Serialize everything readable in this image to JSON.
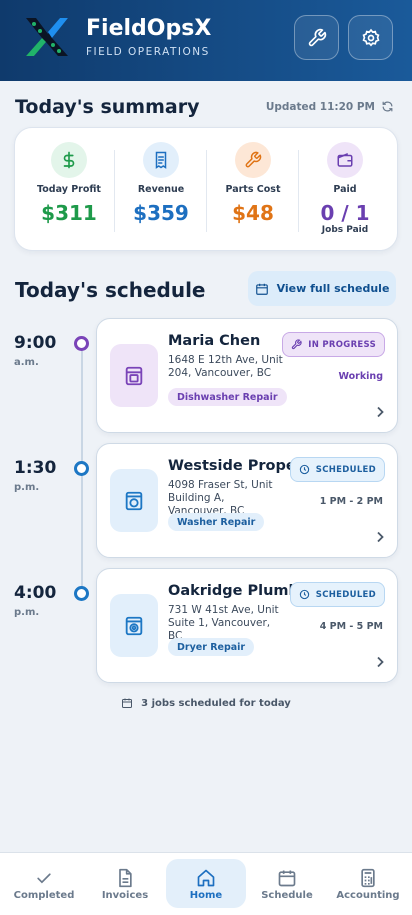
{
  "header": {
    "title": "FieldOpsX",
    "subtitle": "FIELD OPERATIONS",
    "icons": [
      "wrench-icon",
      "settings-gear-icon"
    ]
  },
  "summary": {
    "title": "Today's summary",
    "updated": "Updated 11:20 PM",
    "stats": [
      {
        "label": "Today Profit",
        "value": "$311",
        "icon": "dollar-icon",
        "color": "#1e9a4a"
      },
      {
        "label": "Revenue",
        "value": "$359",
        "icon": "receipt-icon",
        "color": "#1d6fc0"
      },
      {
        "label": "Parts Cost",
        "value": "$48",
        "icon": "wrench-icon",
        "color": "#e07416"
      },
      {
        "label": "Paid",
        "value": "0 / 1",
        "sub": "Jobs Paid",
        "icon": "wallet-icon",
        "color": "#6a3fb0"
      }
    ]
  },
  "schedule": {
    "title": "Today's schedule",
    "view_full": "View full schedule",
    "jobs": [
      {
        "time": "9:00",
        "ampm": "a.m.",
        "name": "Maria Chen",
        "address": "1648 E 12th Ave, Unit 204, Vancouver, BC",
        "tag": "Dishwasher Repair",
        "status": "IN PROGRESS",
        "status_sub": "Working",
        "accent": "#7a44b8"
      },
      {
        "time": "1:30",
        "ampm": "p.m.",
        "name": "Westside Properties",
        "address": "4098 Fraser St, Unit Building A, Vancouver, BC",
        "tag": "Washer Repair",
        "status": "SCHEDULED",
        "status_sub": "1 PM - 2 PM",
        "accent": "#1d77c4"
      },
      {
        "time": "4:00",
        "ampm": "p.m.",
        "name": "Oakridge Plumbing",
        "address": "731 W 41st Ave, Unit Suite 1, Vancouver, BC",
        "tag": "Dryer Repair",
        "status": "SCHEDULED",
        "status_sub": "4 PM - 5 PM",
        "accent": "#1d77c4"
      }
    ],
    "footnote": "3 jobs scheduled for today"
  },
  "nav": {
    "items": [
      {
        "label": "Completed",
        "icon": "check-icon"
      },
      {
        "label": "Invoices",
        "icon": "document-icon"
      },
      {
        "label": "Home",
        "icon": "home-icon",
        "active": true
      },
      {
        "label": "Schedule",
        "icon": "calendar-icon"
      },
      {
        "label": "Accounting",
        "icon": "calculator-icon"
      }
    ]
  }
}
